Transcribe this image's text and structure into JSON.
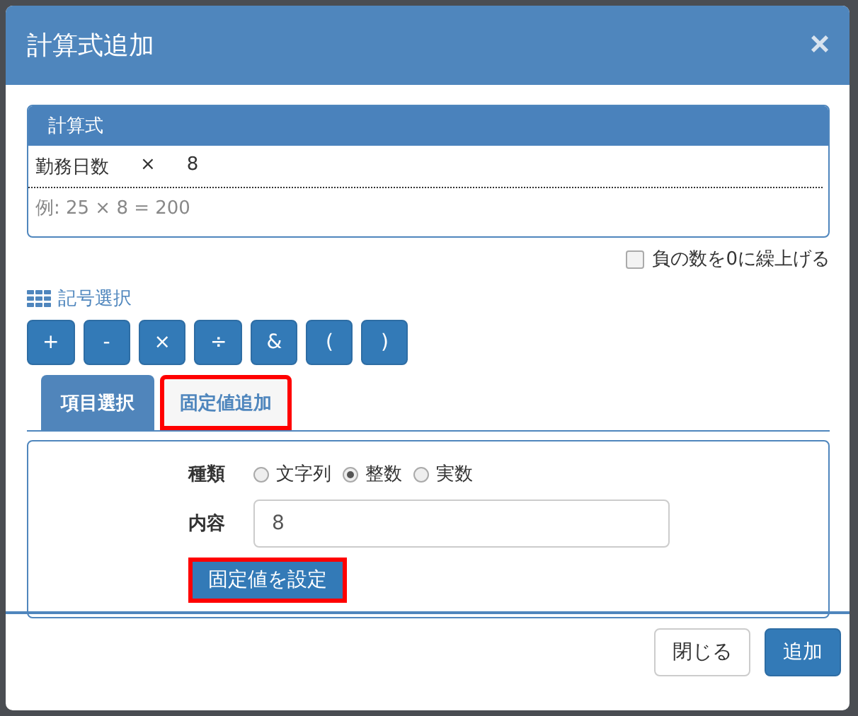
{
  "dialog": {
    "title": "計算式追加",
    "close": "×"
  },
  "formula": {
    "title": "計算式",
    "tokens": [
      "勤務日数",
      "×",
      "8"
    ],
    "example": "例: 25 × 8 = 200"
  },
  "round_up_negative": {
    "label": "負の数を0に繰上げる",
    "checked": false
  },
  "symbols": {
    "title": "記号選択",
    "buttons": [
      "+",
      "-",
      "×",
      "÷",
      "&",
      "(",
      ")"
    ]
  },
  "tabs": [
    {
      "label": "項目選択",
      "selected": false,
      "highlighted": false
    },
    {
      "label": "固定値追加",
      "selected": true,
      "highlighted": true
    }
  ],
  "fixed_value": {
    "type_label": "種類",
    "types": [
      {
        "label": "文字列",
        "selected": false
      },
      {
        "label": "整数",
        "selected": true
      },
      {
        "label": "実数",
        "selected": false
      }
    ],
    "content_label": "内容",
    "content_value": "8",
    "set_button": {
      "label": "固定値を設定",
      "highlighted": true
    }
  },
  "footer": {
    "buttons": [
      {
        "label": "閉じる",
        "kind": "default"
      },
      {
        "label": "追加",
        "kind": "primary"
      }
    ]
  }
}
